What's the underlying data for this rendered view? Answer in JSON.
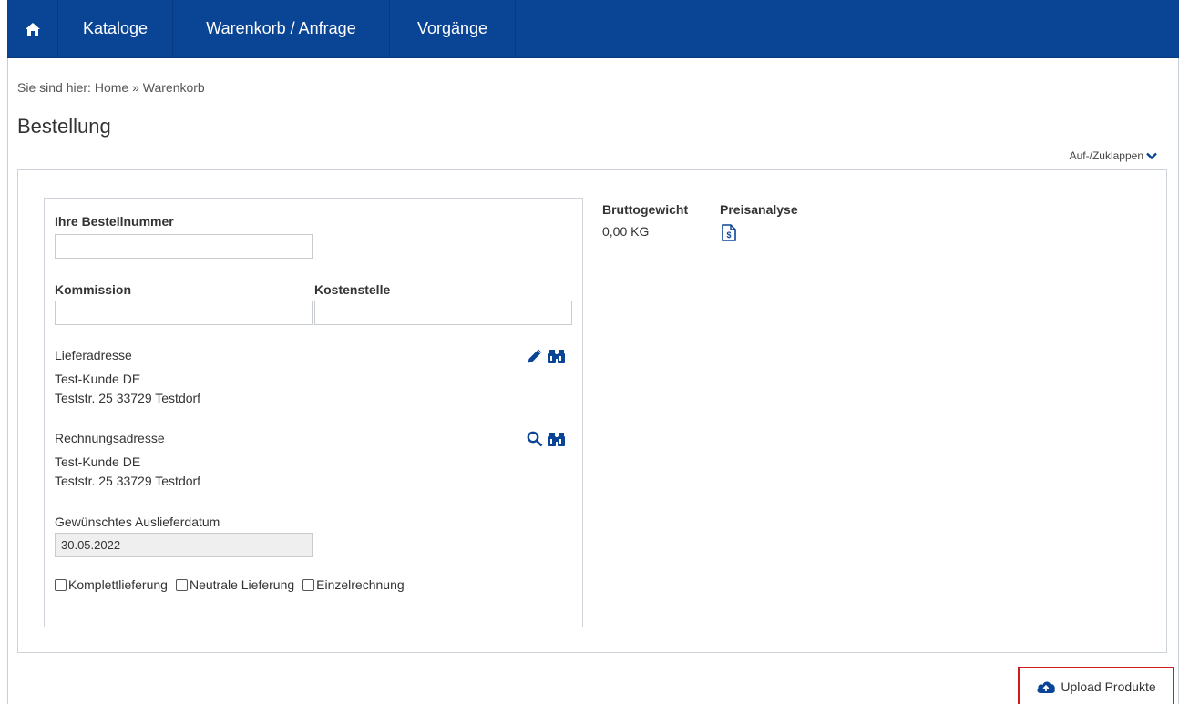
{
  "nav": {
    "home_icon": "home-icon",
    "items": [
      {
        "label": "Kataloge"
      },
      {
        "label": "Warenkorb / Anfrage"
      },
      {
        "label": "Vorgänge"
      }
    ]
  },
  "breadcrumb": {
    "prefix": "Sie sind hier:",
    "home": "Home",
    "separator": "»",
    "current": "Warenkorb"
  },
  "page": {
    "title": "Bestellung",
    "toggle_label": "Auf-/Zuklappen"
  },
  "form": {
    "order_number": {
      "label": "Ihre Bestellnummer",
      "value": ""
    },
    "commission": {
      "label": "Kommission",
      "value": ""
    },
    "cost_center": {
      "label": "Kostenstelle",
      "value": ""
    },
    "delivery_address": {
      "label": "Lieferadresse",
      "line1": "Test-Kunde DE",
      "line2": "Teststr. 25 33729 Testdorf"
    },
    "billing_address": {
      "label": "Rechnungsadresse",
      "line1": "Test-Kunde DE",
      "line2": "Teststr. 25 33729 Testdorf"
    },
    "delivery_date": {
      "label": "Gewünschtes Auslieferdatum",
      "value": "30.05.2022"
    },
    "checkboxes": [
      {
        "label": "Komplettlieferung",
        "checked": false
      },
      {
        "label": "Neutrale Lieferung",
        "checked": false
      },
      {
        "label": "Einzelrechnung",
        "checked": false
      }
    ]
  },
  "summary": {
    "weight_label": "Bruttogewicht",
    "weight_value": "0,00 KG",
    "price_label": "Preisanalyse"
  },
  "upload": {
    "label": "Upload Produkte"
  },
  "colors": {
    "nav_bg": "#0a4595",
    "icon_blue": "#0a4595",
    "highlight_border": "#d11a1a"
  }
}
